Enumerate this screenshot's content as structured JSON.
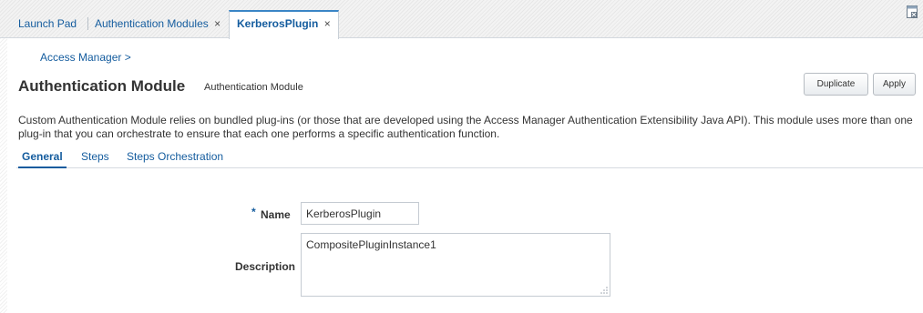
{
  "tabs": [
    {
      "label": "Launch Pad",
      "closable": false,
      "active": false
    },
    {
      "label": "Authentication Modules",
      "closable": true,
      "active": false
    },
    {
      "label": "KerberosPlugin",
      "closable": true,
      "active": true
    }
  ],
  "tab_close_glyph": "×",
  "toolbar_icons": {
    "maximize": "maximize-icon"
  },
  "breadcrumb": "Access Manager >",
  "page": {
    "title": "Authentication Module",
    "subtitle": "Authentication Module"
  },
  "buttons": {
    "duplicate": "Duplicate",
    "apply": "Apply"
  },
  "description": "Custom Authentication Module relies on bundled plug-ins (or those that are developed using the Access Manager Authentication Extensibility Java API). This module uses more than one plug-in that you can orchestrate to ensure that each one performs a specific authentication function.",
  "subtabs": [
    {
      "label": "General",
      "active": true
    },
    {
      "label": "Steps",
      "active": false
    },
    {
      "label": "Steps Orchestration",
      "active": false
    }
  ],
  "form": {
    "required_marker": "*",
    "name_label": "Name",
    "name_value": "KerberosPlugin",
    "description_label": "Description",
    "description_value": "CompositePluginInstance1"
  },
  "colors": {
    "link": "#145c9e",
    "active_tab_border": "#3a85c6",
    "text": "#333333"
  }
}
